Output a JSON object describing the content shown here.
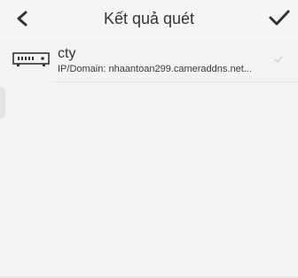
{
  "header": {
    "title": "Kết quả quét",
    "back_icon": "chevron-left-icon",
    "confirm_icon": "checkmark-icon"
  },
  "devices": [
    {
      "icon": "dvr-recorder-icon",
      "name": "cty",
      "address": "IP/Domain: nhaantoan299.cameraddns.net...",
      "selected": false
    }
  ],
  "colors": {
    "background": "#f4f6f3",
    "text": "#333333",
    "divider": "#e2e5e1"
  }
}
